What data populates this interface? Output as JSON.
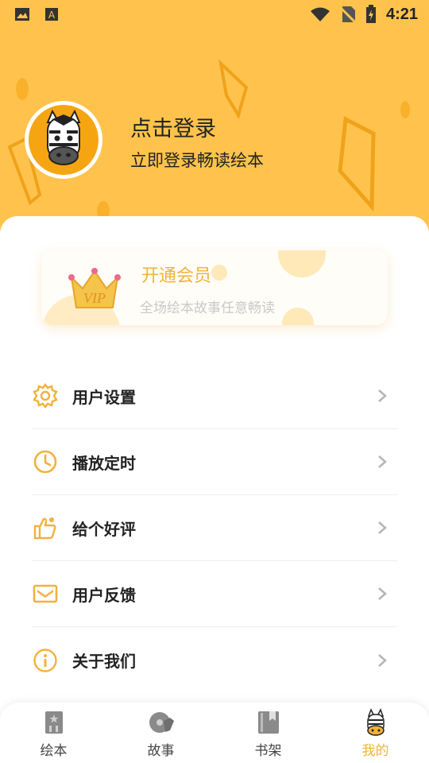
{
  "status_bar": {
    "time": "4:21"
  },
  "profile": {
    "title": "点击登录",
    "subtitle": "立即登录畅读绘本"
  },
  "vip": {
    "crown_text": "VIP",
    "title": "开通会员",
    "subtitle": "全场绘本故事任意畅读"
  },
  "menu": [
    {
      "label": "用户设置",
      "icon": "gear-icon"
    },
    {
      "label": "播放定时",
      "icon": "clock-icon"
    },
    {
      "label": "给个好评",
      "icon": "thumbs-up-icon"
    },
    {
      "label": "用户反馈",
      "icon": "envelope-icon"
    },
    {
      "label": "关于我们",
      "icon": "info-icon"
    }
  ],
  "tabs": [
    {
      "label": "绘本",
      "icon": "picture-book-icon"
    },
    {
      "label": "故事",
      "icon": "story-icon"
    },
    {
      "label": "书架",
      "icon": "bookshelf-icon"
    },
    {
      "label": "我的",
      "icon": "zebra-mine-icon",
      "active": true
    }
  ],
  "colors": {
    "header": "#ffc34d",
    "accent": "#f3b13b",
    "avatar_bg": "#f6a512",
    "text": "#222222"
  }
}
